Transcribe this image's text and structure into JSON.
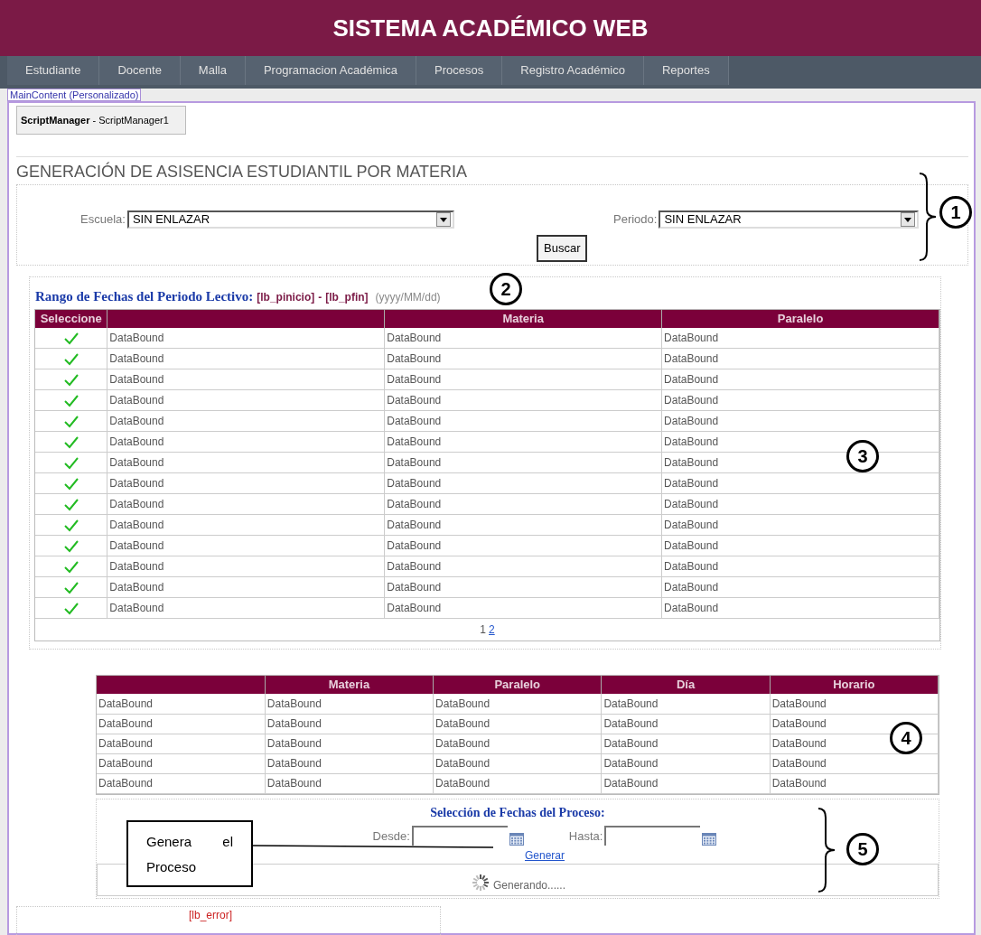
{
  "header": {
    "title": "SISTEMA ACADÉMICO WEB"
  },
  "nav": {
    "items": [
      "Estudiante",
      "Docente",
      "Malla",
      "Programacion Académica",
      "Procesos",
      "Registro Académico",
      "Reportes"
    ]
  },
  "designer": {
    "content_tag": "MainContent (Personalizado)",
    "script_manager": {
      "type": "ScriptManager",
      "id": "- ScriptManager1"
    }
  },
  "page_title": "GENERACIÓN DE ASISENCIA ESTUDIANTIL POR MATERIA",
  "filters": [
    {
      "label": "Escuela:",
      "value": "SIN ENLAZAR"
    },
    {
      "label": "Periodo:",
      "value": "SIN ENLAZAR"
    }
  ],
  "search_button": "Buscar",
  "date_range": {
    "label": "Rango de Fechas del Periodo Lectivo:",
    "start": "[lb_pinicio]",
    "separator": "-",
    "end": "[lb_pfin]",
    "format": "(yyyy/MM/dd)"
  },
  "subjects_table": {
    "columns": [
      "Seleccione",
      "",
      "Materia",
      "Paralelo"
    ],
    "rows": [
      [
        "",
        "DataBound",
        "DataBound",
        "DataBound"
      ],
      [
        "",
        "DataBound",
        "DataBound",
        "DataBound"
      ],
      [
        "",
        "DataBound",
        "DataBound",
        "DataBound"
      ],
      [
        "",
        "DataBound",
        "DataBound",
        "DataBound"
      ],
      [
        "",
        "DataBound",
        "DataBound",
        "DataBound"
      ],
      [
        "",
        "DataBound",
        "DataBound",
        "DataBound"
      ],
      [
        "",
        "DataBound",
        "DataBound",
        "DataBound"
      ],
      [
        "",
        "DataBound",
        "DataBound",
        "DataBound"
      ],
      [
        "",
        "DataBound",
        "DataBound",
        "DataBound"
      ],
      [
        "",
        "DataBound",
        "DataBound",
        "DataBound"
      ],
      [
        "",
        "DataBound",
        "DataBound",
        "DataBound"
      ],
      [
        "",
        "DataBound",
        "DataBound",
        "DataBound"
      ],
      [
        "",
        "DataBound",
        "DataBound",
        "DataBound"
      ],
      [
        "",
        "DataBound",
        "DataBound",
        "DataBound"
      ]
    ],
    "pager": [
      {
        "label": "1",
        "selected": true
      },
      {
        "label": "2",
        "selected": false
      }
    ]
  },
  "schedule_table": {
    "columns": [
      "",
      "Materia",
      "Paralelo",
      "Día",
      "Horario"
    ],
    "rows": [
      [
        "DataBound",
        "DataBound",
        "DataBound",
        "DataBound",
        "DataBound"
      ],
      [
        "DataBound",
        "DataBound",
        "DataBound",
        "DataBound",
        "DataBound"
      ],
      [
        "DataBound",
        "DataBound",
        "DataBound",
        "DataBound",
        "DataBound"
      ],
      [
        "DataBound",
        "DataBound",
        "DataBound",
        "DataBound",
        "DataBound"
      ],
      [
        "DataBound",
        "DataBound",
        "DataBound",
        "DataBound",
        "DataBound"
      ]
    ]
  },
  "process": {
    "title": "Selección de Fechas del Proceso:",
    "from_label": "Desde:",
    "to_label": "Hasta:",
    "generate_link": "Generar",
    "progress_text": "Generando......",
    "error_label": "[lb_error]"
  },
  "annotations": {
    "markers": [
      "1",
      "2",
      "3",
      "4",
      "5"
    ],
    "callout": "Genera el Proceso"
  }
}
